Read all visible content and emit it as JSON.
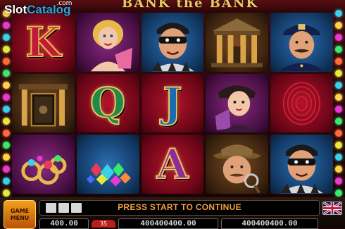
{
  "game": {
    "title": "BANK the BANK"
  },
  "watermark": {
    "brand_prefix": "Slot",
    "brand_suffix": "Catalog",
    "tld": ".com"
  },
  "reels": [
    [
      "K-letter",
      "showgirl",
      "masked-robber",
      "bank-building",
      "policeman"
    ],
    [
      "bank-vault-door",
      "Q-letter",
      "J-letter",
      "lady-with-fan",
      "fingerprint"
    ],
    [
      "gold-rings",
      "gem-pile",
      "A-letter",
      "detective",
      "masked-robber"
    ]
  ],
  "letters": {
    "k": "K",
    "q": "Q",
    "j": "J",
    "a": "A"
  },
  "controls": {
    "menu_line1": "GAME",
    "menu_line2": "MENU",
    "message": "PRESS START TO CONTINUE",
    "credit_left": "400.00",
    "bet_chip": "35",
    "credit_mid": "400400400.00",
    "credit_right": "400400400.00"
  },
  "colors": {
    "accent": "#f0a040",
    "menu_button": "#e88a14",
    "frame": "#2a0507"
  }
}
